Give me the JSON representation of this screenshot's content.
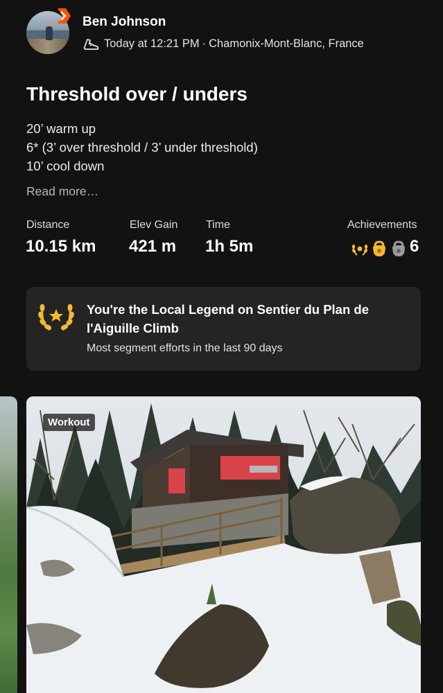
{
  "header": {
    "athlete_name": "Ben Johnson",
    "timestamp": "Today at 12:21 PM",
    "location": "Chamonix-Mont-Blanc, France",
    "separator": "·",
    "avatar_icon": "athlete-avatar",
    "badge_icon": "subscriber-chevron-badge",
    "activity_type_icon": "running-shoe-icon",
    "accent_color": "#fc5200"
  },
  "activity": {
    "title": "Threshold over / unders",
    "description_lines": [
      "20’ warm up",
      "6* (3’ over threshold / 3’ under threshold)",
      "10’ cool down"
    ],
    "read_more": "Read more…"
  },
  "stats": [
    {
      "label": "Distance",
      "value": "10.15 km"
    },
    {
      "label": "Elev Gain",
      "value": "421 m"
    },
    {
      "label": "Time",
      "value": "1h 5m"
    }
  ],
  "achievements": {
    "label": "Achievements",
    "count": "6",
    "icons": [
      "local-legend-laurel-icon",
      "gold-kudos-kettlebell-icon",
      "silver-kettlebell-icon"
    ],
    "colors": {
      "gold": "#f5b82e",
      "silver": "#9a9a9a"
    }
  },
  "legend_card": {
    "icon": "laurel-wreath-icon",
    "title": "You're the Local Legend on Sentier du Plan de l'Aiguille Climb",
    "subtitle": "Most segment efforts in the last 90 days",
    "background": "#242424"
  },
  "media": {
    "map_thumbnail": "route-map-thumbnail",
    "photo_tag": "Workout",
    "photo_subject": "snowy-forest-cabin-photo"
  }
}
